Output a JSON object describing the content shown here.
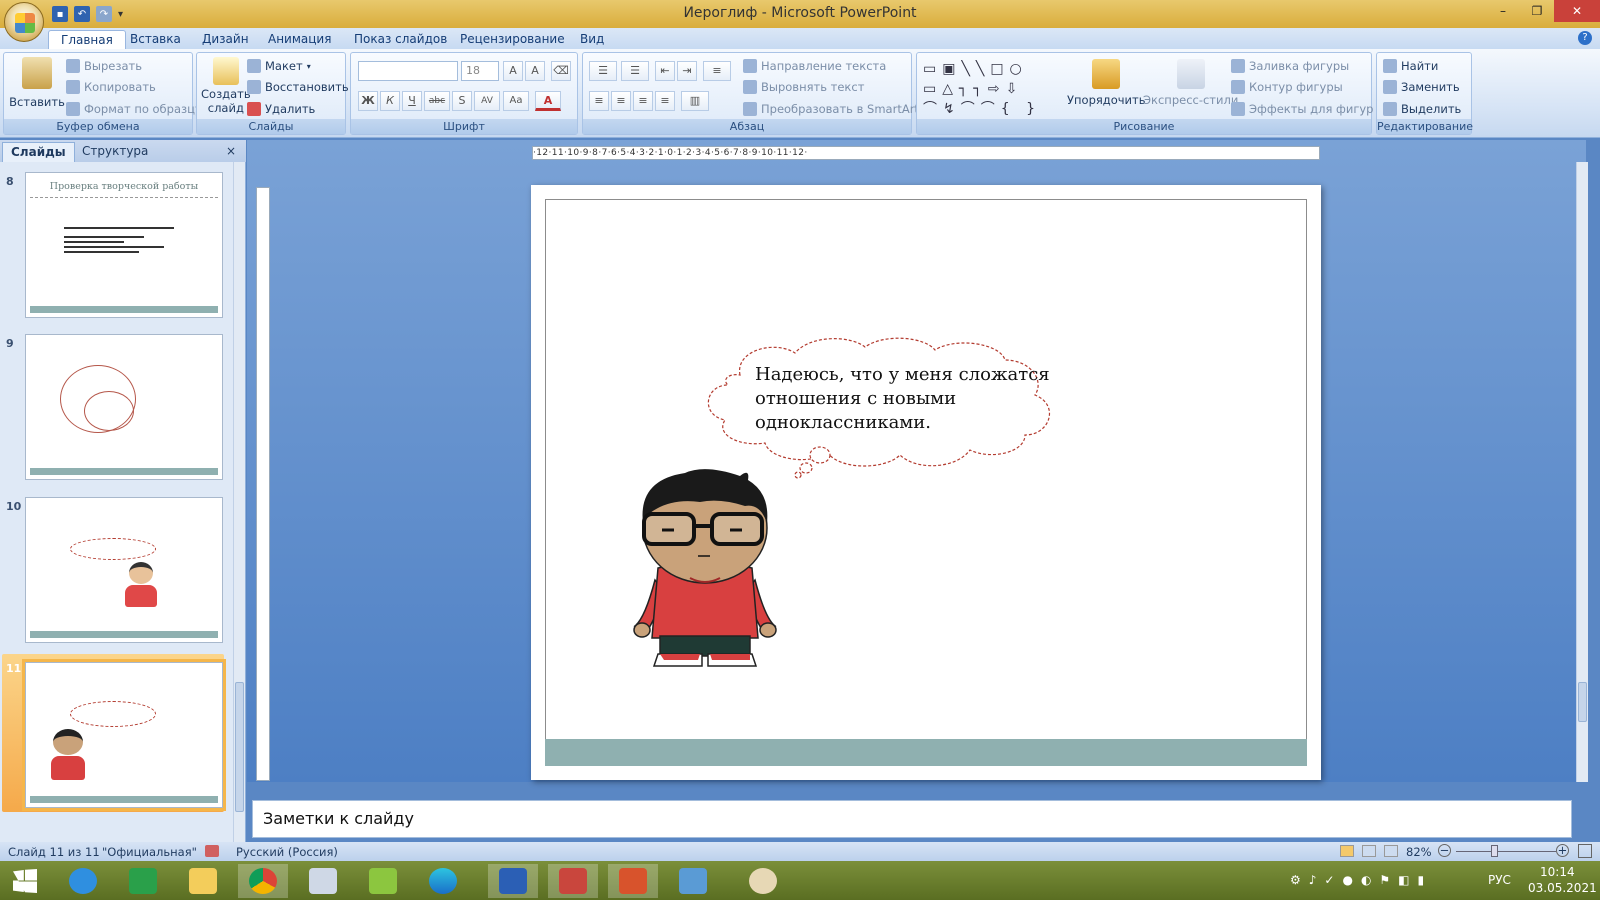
{
  "window": {
    "title": "Иероглиф - Microsoft PowerPoint"
  },
  "tabs": [
    "Главная",
    "Вставка",
    "Дизайн",
    "Анимация",
    "Показ слайдов",
    "Рецензирование",
    "Вид"
  ],
  "clipboard": {
    "paste": "Вставить",
    "cut": "Вырезать",
    "copy": "Копировать",
    "format": "Формат по образцу",
    "label": "Буфер обмена"
  },
  "slides_group": {
    "create": "Создать",
    "create2": "слайд",
    "layout": "Макет",
    "reset": "Восстановить",
    "delete": "Удалить",
    "label": "Слайды"
  },
  "font_group": {
    "size": "18",
    "label": "Шрифт",
    "bold": "Ж",
    "italic": "К",
    "underline": "Ч",
    "strike": "abc",
    "shadow": "S",
    "spacing": "AV",
    "case": "Aa",
    "color": "A"
  },
  "paragraph_group": {
    "direction": "Направление текста",
    "align": "Выровнять текст",
    "smartart": "Преобразовать в SmartArt",
    "label": "Абзац"
  },
  "drawing_group": {
    "arrange": "Упорядочить",
    "styles": "Экспресс-стили",
    "fill": "Заливка фигуры",
    "outline": "Контур фигуры",
    "effects": "Эффекты для фигур",
    "label": "Рисование"
  },
  "editing_group": {
    "find": "Найти",
    "replace": "Заменить",
    "select": "Выделить",
    "label": "Редактирование"
  },
  "panel": {
    "tab_slides": "Слайды",
    "tab_outline": "Структура",
    "close": "×"
  },
  "thumbnails": [
    {
      "num": "8",
      "title": "Проверка творческой работы"
    },
    {
      "num": "9"
    },
    {
      "num": "10"
    },
    {
      "num": "11"
    }
  ],
  "slide": {
    "bubble_text": "Надеюсь, что у меня сложатся отношения с новыми одноклассниками."
  },
  "ruler": {
    "h": "·12·11·10·9·8·7·6·5·4·3·2·1·0·1·2·3·4·5·6·7·8·9·10·11·12·"
  },
  "notes": {
    "placeholder": "Заметки к слайду"
  },
  "status": {
    "slide": "Слайд 11 из 11",
    "theme": "\"Официальная\"",
    "lang": "Русский (Россия)",
    "zoom": "82%"
  },
  "tray": {
    "lang": "РУС",
    "time": "10:14",
    "date": "03.05.2021"
  },
  "colors": {
    "shirt": "#e04848",
    "accent": "#2d70c9",
    "footer": "#8fb0b0",
    "bubble": "#b33b2f"
  }
}
